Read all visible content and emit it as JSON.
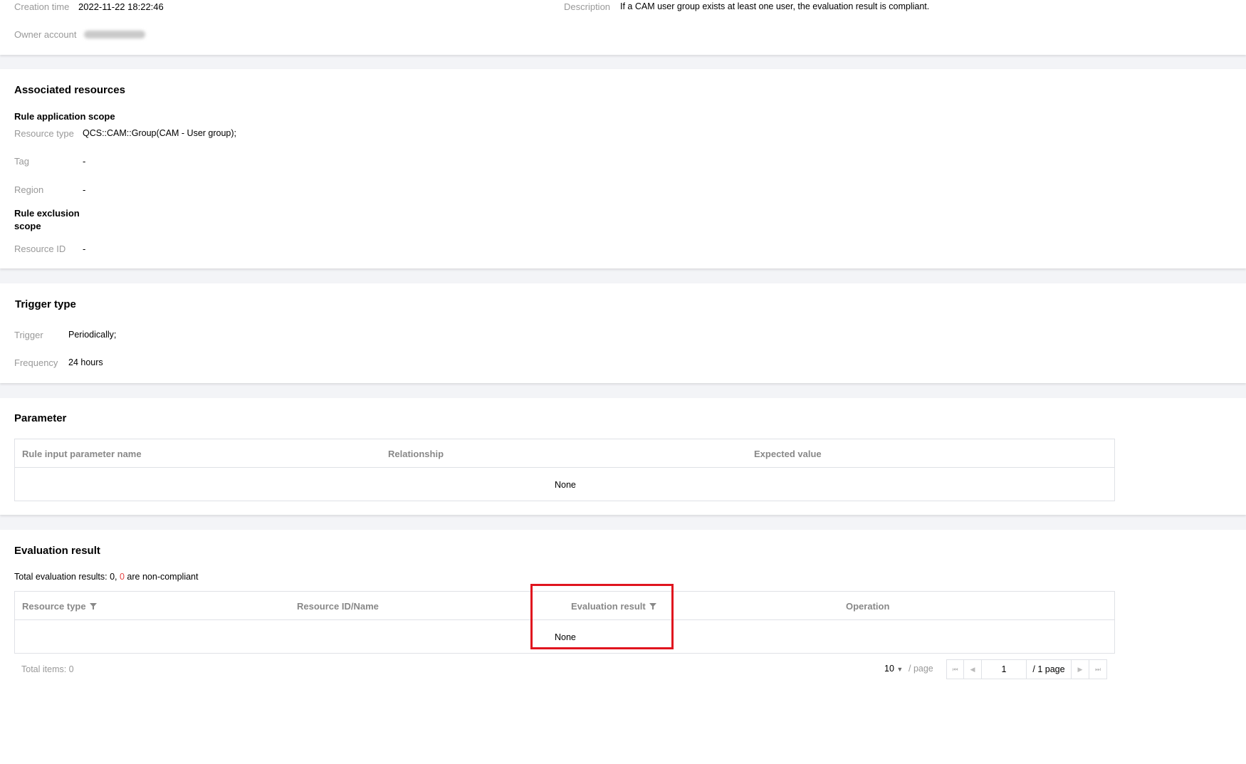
{
  "basic_info": {
    "creation_time_label": "Creation time",
    "creation_time_value": "2022-11-22 18:22:46",
    "owner_account_label": "Owner account",
    "description_label": "Description",
    "description_value": "If a CAM user group exists at least one user, the evaluation result is compliant."
  },
  "associated_resources": {
    "title": "Associated resources",
    "scope_title": "Rule application scope",
    "resource_type_label": "Resource type",
    "resource_type_value": "QCS::CAM::Group(CAM - User group);",
    "tag_label": "Tag",
    "tag_value": "-",
    "region_label": "Region",
    "region_value": "-",
    "exclusion_title_line1": "Rule exclusion",
    "exclusion_title_line2": "scope",
    "resource_id_label": "Resource ID",
    "resource_id_value": "-"
  },
  "trigger": {
    "title": "Trigger type",
    "trigger_label": "Trigger",
    "trigger_value": "Periodically;",
    "frequency_label": "Frequency",
    "frequency_value": "24 hours"
  },
  "parameter": {
    "title": "Parameter",
    "columns": [
      "Rule input parameter name",
      "Relationship",
      "Expected value"
    ],
    "empty_text": "None"
  },
  "evaluation": {
    "title": "Evaluation result",
    "summary_prefix": "Total evaluation results: 0, ",
    "summary_count": "0",
    "summary_suffix": " are non-compliant",
    "columns": [
      "Resource type",
      "Resource ID/Name",
      "Evaluation result",
      "Operation"
    ],
    "empty_text": "None",
    "total_items": "Total items:  0",
    "page_size": "10",
    "page_size_suffix": "/ page",
    "current_page": "1",
    "page_total": "/ 1 page"
  },
  "colors": {
    "highlight": "#e0141e",
    "danger_count": "#e54545"
  }
}
